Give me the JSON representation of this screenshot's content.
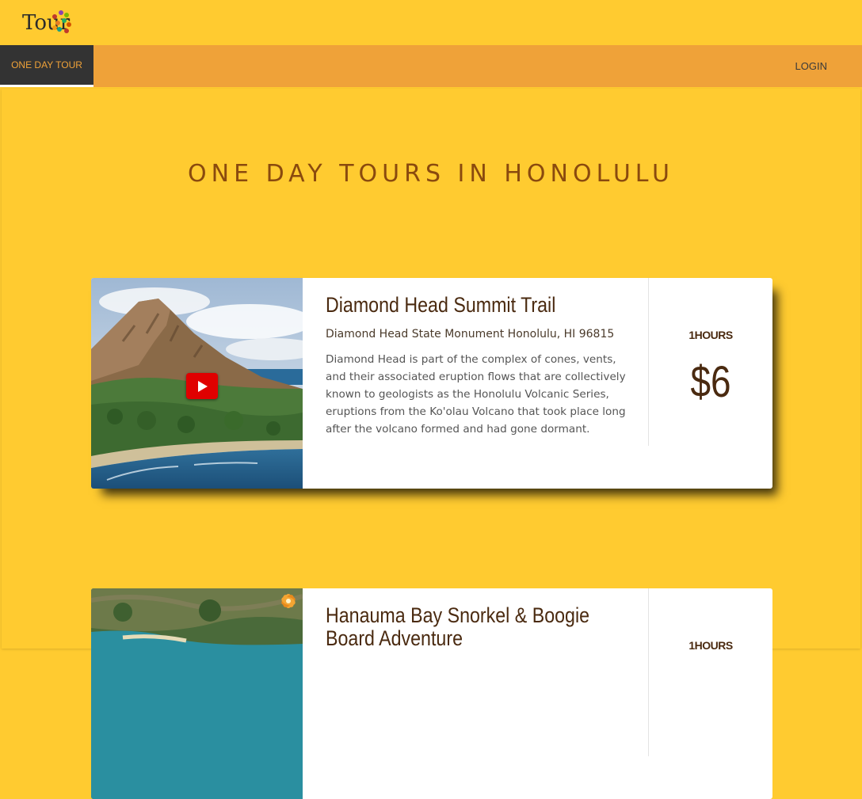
{
  "header": {
    "logo_text": "Tour"
  },
  "nav": {
    "active_tab": "ONE DAY TOUR",
    "login": "LOGIN"
  },
  "page": {
    "title": "ONE DAY TOURS IN HONOLULU"
  },
  "tours": [
    {
      "title": "Diamond Head Summit Trail",
      "address": "Diamond Head State Monument Honolulu, HI 96815",
      "description": "Diamond Head is part of the complex of cones, vents, and their associated eruption flows that are collectively known to geologists as the Honolulu Volcanic Series, eruptions from the Ko'olau Volcano that took place long after the volcano formed and had gone dormant.",
      "hours": "1HOURS",
      "price": "$6",
      "image_icon": "youtube-play-icon"
    },
    {
      "title": "Hanauma Bay Snorkel & Boogie Board Adventure",
      "hours": "1HOURS",
      "image_icon": "flower-badge-icon"
    }
  ],
  "colors": {
    "background": "#ffcb30",
    "navbar": "#efa239",
    "active_tab_bg": "#333333",
    "title_text": "#8a4a0e",
    "card_text": "#4a2a10",
    "play_button": "#e00000"
  }
}
